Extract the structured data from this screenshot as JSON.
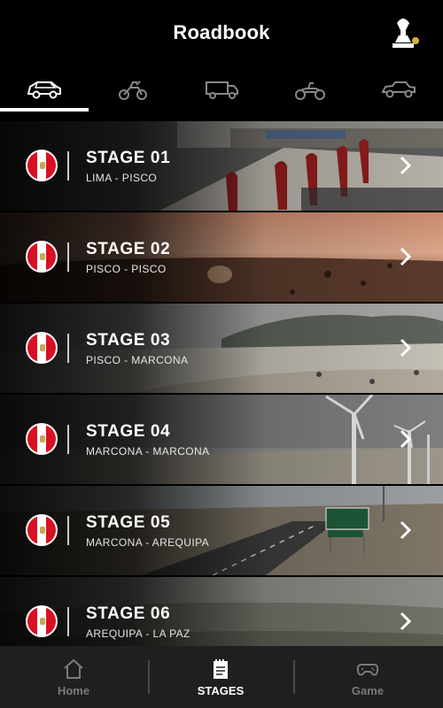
{
  "header": {
    "title": "Roadbook",
    "logo_icon": "dakar-logo-icon"
  },
  "tabs": [
    {
      "icon": "car-icon",
      "active": true
    },
    {
      "icon": "motorbike-icon",
      "active": false
    },
    {
      "icon": "truck-icon",
      "active": false
    },
    {
      "icon": "quad-icon",
      "active": false
    },
    {
      "icon": "ssv-icon",
      "active": false
    }
  ],
  "stages": [
    {
      "title": "STAGE 01",
      "route": "LIMA - PISCO",
      "flag": "peru-flag-icon"
    },
    {
      "title": "STAGE 02",
      "route": "PISCO - PISCO",
      "flag": "peru-flag-icon"
    },
    {
      "title": "STAGE 03",
      "route": "PISCO - MARCONA",
      "flag": "peru-flag-icon"
    },
    {
      "title": "STAGE 04",
      "route": "MARCONA - MARCONA",
      "flag": "peru-flag-icon"
    },
    {
      "title": "STAGE 05",
      "route": "MARCONA - AREQUIPA",
      "flag": "peru-flag-icon"
    },
    {
      "title": "STAGE 06",
      "route": "AREQUIPA - LA PAZ",
      "flag": "peru-flag-icon"
    }
  ],
  "nav": {
    "home": "Home",
    "stages": "STAGES",
    "game": "Game"
  },
  "colors": {
    "background": "#000000",
    "nav_background": "#1f1f1f",
    "flag_red": "#d91023",
    "inactive": "#7a7a7a"
  }
}
